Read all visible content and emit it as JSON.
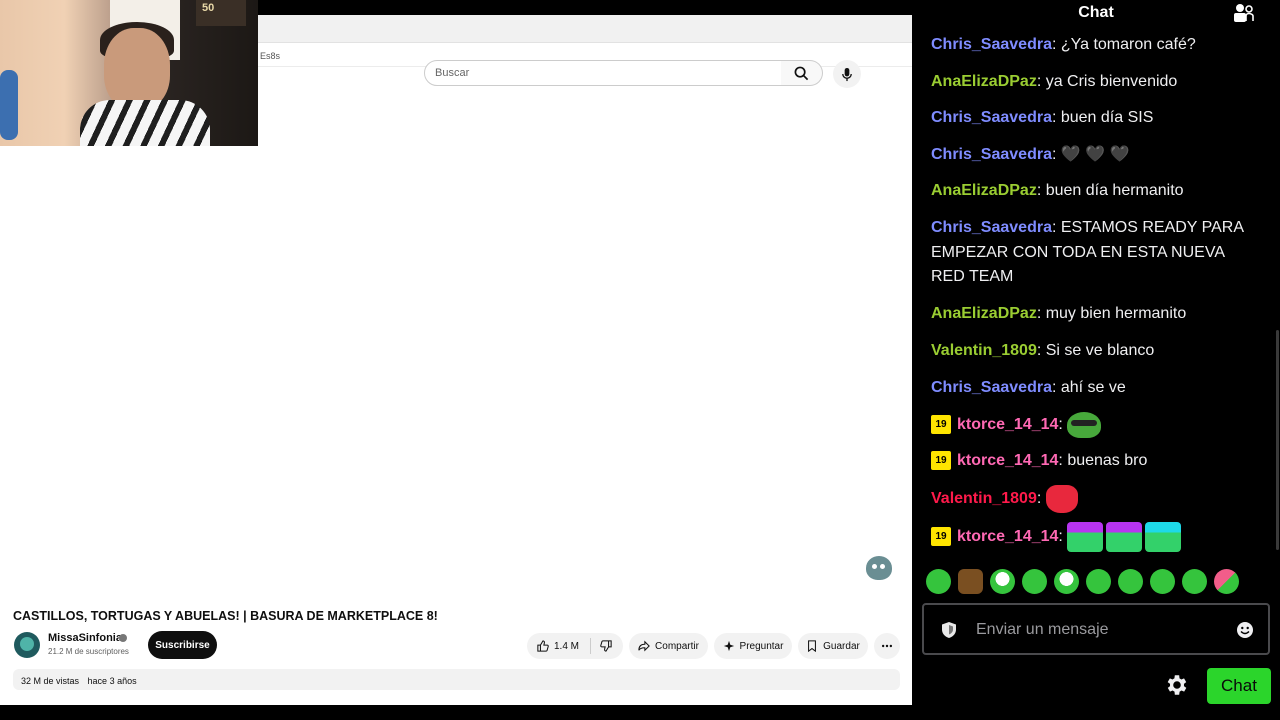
{
  "browser": {
    "url_fragment": "Es8s"
  },
  "youtube": {
    "search_placeholder": "Buscar",
    "video_title": "CASTILLOS, TORTUGAS Y ABUELAS! | BASURA DE MARKETPLACE 8!",
    "channel_name": "MissaSinfonia",
    "channel_subscribers": "21.2 M de suscriptores",
    "subscribe_label": "Suscribirse",
    "like_count": "1.4 M",
    "share_label": "Compartir",
    "ask_label": "Preguntar",
    "save_label": "Guardar",
    "views": "32 M de vistas",
    "posted": "hace 3 años"
  },
  "webcam": {
    "poster_text": "50"
  },
  "chat": {
    "title": "Chat",
    "messages": [
      {
        "user": "Chris_Saavedra",
        "color": "#7f8cff",
        "text": "¿Ya tomaron café?"
      },
      {
        "user": "AnaElizaDPaz",
        "color": "#9acd32",
        "text": "ya Cris bienvenido"
      },
      {
        "user": "Chris_Saavedra",
        "color": "#7f8cff",
        "text": "buen día SIS"
      },
      {
        "user": "Chris_Saavedra",
        "color": "#7f8cff",
        "text": "🖤 🖤 🖤"
      },
      {
        "user": "AnaElizaDPaz",
        "color": "#9acd32",
        "text": "buen día hermanito"
      },
      {
        "user": "Chris_Saavedra",
        "color": "#7f8cff",
        "text": "ESTAMOS READY PARA EMPEZAR CON TODA EN ESTA NUEVA RED TEAM"
      },
      {
        "user": "AnaElizaDPaz",
        "color": "#9acd32",
        "text": "muy bien hermanito"
      },
      {
        "user": "Valentin_1809",
        "color": "#9acd32",
        "text": "Si se ve blanco"
      },
      {
        "user": "Chris_Saavedra",
        "color": "#7f8cff",
        "text": "ahí se ve"
      },
      {
        "user": "ktorce_14_14",
        "color": "#ff69b4",
        "badge": "19",
        "text": ""
      },
      {
        "user": "ktorce_14_14",
        "color": "#ff69b4",
        "badge": "19",
        "text": "buenas bro"
      },
      {
        "user": "Valentin_1809",
        "color": "#ff1a4b",
        "text": ""
      },
      {
        "user": "ktorce_14_14",
        "color": "#ff69b4",
        "badge": "19",
        "text": ""
      }
    ],
    "input_placeholder": "Enviar un mensaje",
    "send_label": "Chat",
    "accent_color": "#2bd52b"
  }
}
